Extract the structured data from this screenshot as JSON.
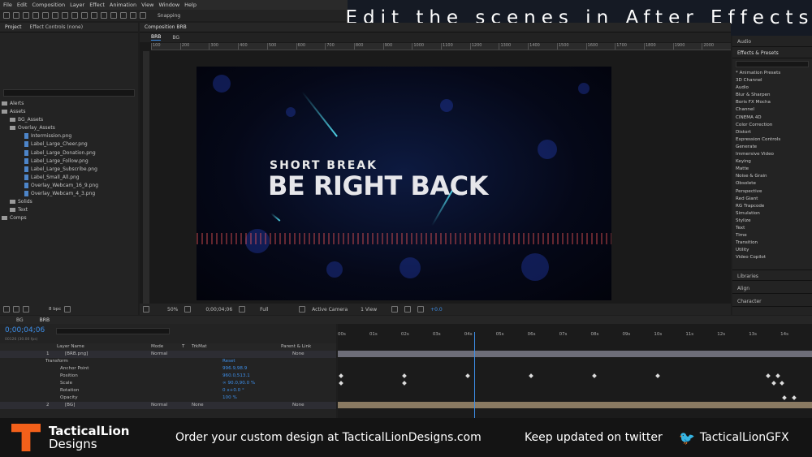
{
  "banner": "Edit the scenes in After Effects",
  "menu": [
    "File",
    "Edit",
    "Composition",
    "Layer",
    "Effect",
    "Animation",
    "View",
    "Window",
    "Help"
  ],
  "toolbar": {
    "snapping": "Snapping"
  },
  "project": {
    "tabs": [
      "Project",
      "Effect Controls (none)"
    ],
    "tree": [
      "Alerts",
      "Assets",
      "BG_Assets",
      "Overlay_Assets",
      "Intermission.png",
      "Label_Large_Cheer.png",
      "Label_Large_Donation.png",
      "Label_Large_Follow.png",
      "Label_Large_Subscribe.png",
      "Label_Small_All.png",
      "Overlay_Webcam_16_9.png",
      "Overlay_Webcam_4_3.png",
      "Solids",
      "Text",
      "Comps"
    ],
    "bpc": "8 bpc"
  },
  "comp": {
    "tab": "Composition BRB",
    "subtabs": [
      "BRB",
      "BG"
    ],
    "ruler": [
      "100",
      "200",
      "300",
      "400",
      "500",
      "600",
      "700",
      "800",
      "900",
      "1000",
      "1100",
      "1200",
      "1300",
      "1400",
      "1500",
      "1600",
      "1700",
      "1800",
      "1900",
      "2000"
    ],
    "title_small": "SHORT BREAK",
    "title_big": "BE RIGHT BACK",
    "zoom": "50%",
    "time": "0;00;04;06",
    "resolution": "Full",
    "camera": "Active Camera",
    "view": "1 View",
    "offset": "+0.0"
  },
  "panels": {
    "audio": "Audio",
    "effects": "Effects & Presets",
    "libraries": "Libraries",
    "align": "Align",
    "character": "Character",
    "effect_list": [
      "* Animation Presets",
      "3D Channel",
      "Audio",
      "Blur & Sharpen",
      "Boris FX Mocha",
      "Channel",
      "CINEMA 4D",
      "Color Correction",
      "Distort",
      "Expression Controls",
      "Generate",
      "Immersive Video",
      "Keying",
      "Matte",
      "Noise & Grain",
      "Obsolete",
      "Perspective",
      "Red Giant",
      "RG Trapcode",
      "Simulation",
      "Stylize",
      "Text",
      "Time",
      "Transition",
      "Utility",
      "Video Copilot"
    ]
  },
  "timeline": {
    "tabs": [
      "BG",
      "BRB"
    ],
    "timecode": "0;00;04;06",
    "fps": "00126 (30.00 fps)",
    "cols": {
      "name": "Layer Name",
      "mode": "Mode",
      "t": "T",
      "trkmat": "TrkMat",
      "parent": "Parent & Link"
    },
    "ticks": [
      "00s",
      "01s",
      "02s",
      "03s",
      "04s",
      "05s",
      "06s",
      "07s",
      "08s",
      "09s",
      "10s",
      "11s",
      "12s",
      "13s",
      "14s"
    ],
    "layers": [
      {
        "num": "1",
        "name": "[BRB.png]",
        "mode": "Normal",
        "trkmat": "",
        "parent": "None"
      },
      {
        "num": "2",
        "name": "[BG]",
        "mode": "Normal",
        "trkmat": "None",
        "parent": "None"
      }
    ],
    "transform": "Transform",
    "reset": "Reset",
    "props": [
      {
        "name": "Anchor Point",
        "value": "996.9,98.9"
      },
      {
        "name": "Position",
        "value": "960.0,513.1"
      },
      {
        "name": "Scale",
        "value": "∞ 90.0,90.0 %"
      },
      {
        "name": "Rotation",
        "value": "0 x+0.0 °"
      },
      {
        "name": "Opacity",
        "value": "100 %"
      }
    ]
  },
  "footer": {
    "brand1": "TacticalLion",
    "brand2": "Designs",
    "cta": "Order your custom design at TacticalLionDesigns.com",
    "twitter": "Keep updated on twitter",
    "handle": "TacticalLionGFX"
  },
  "colors": {
    "accent": "#f3601a",
    "banner_bg": "#151a24",
    "timecode": "#3d8ee8"
  }
}
